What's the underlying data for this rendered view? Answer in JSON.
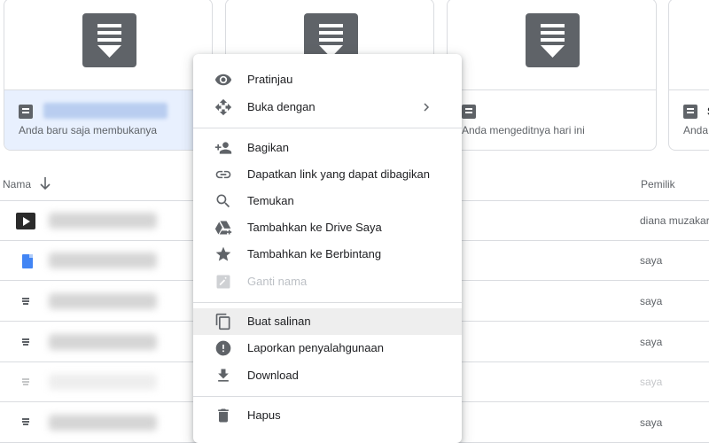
{
  "quick_access": [
    {
      "subtitle": "Anda baru saja membukanya"
    },
    {
      "subtitle": ""
    },
    {
      "subtitle": "Anda mengeditnya hari ini"
    },
    {
      "name_fragment": "S",
      "subtitle": "Anda m"
    }
  ],
  "list": {
    "name_header": "Nama",
    "owner_header": "Pemilik",
    "rows": [
      {
        "icon": "video-icon",
        "owner": "diana muzakar"
      },
      {
        "icon": "google-doc-icon",
        "owner": "saya"
      },
      {
        "icon": "file-icon",
        "owner": "saya"
      },
      {
        "icon": "file-icon",
        "owner": "saya"
      },
      {
        "icon": "file-icon",
        "owner": "saya"
      },
      {
        "icon": "file-icon",
        "owner": "saya"
      }
    ]
  },
  "context_menu": {
    "items": [
      {
        "label": "Pratinjau",
        "icon": "eye-icon"
      },
      {
        "label": "Buka dengan",
        "icon": "move-icon"
      },
      {
        "label": "Bagikan",
        "icon": "add-person-icon"
      },
      {
        "label": "Dapatkan link yang dapat dibagikan",
        "icon": "link-icon"
      },
      {
        "label": "Temukan",
        "icon": "search-icon"
      },
      {
        "label": "Tambahkan ke Drive Saya",
        "icon": "add-to-drive-icon"
      },
      {
        "label": "Tambahkan ke Berbintang",
        "icon": "star-icon"
      },
      {
        "label": "Ganti nama",
        "icon": "edit-icon"
      },
      {
        "label": "Buat salinan",
        "icon": "copy-icon"
      },
      {
        "label": "Laporkan penyalahgunaan",
        "icon": "report-icon"
      },
      {
        "label": "Download",
        "icon": "download-icon"
      },
      {
        "label": "Hapus",
        "icon": "trash-icon"
      }
    ]
  },
  "colors": {
    "selected_card": "#e8f0fe",
    "doc_blue": "#4285f4",
    "icon_grey": "#5f6368",
    "hover_row": "#eeeeee"
  }
}
